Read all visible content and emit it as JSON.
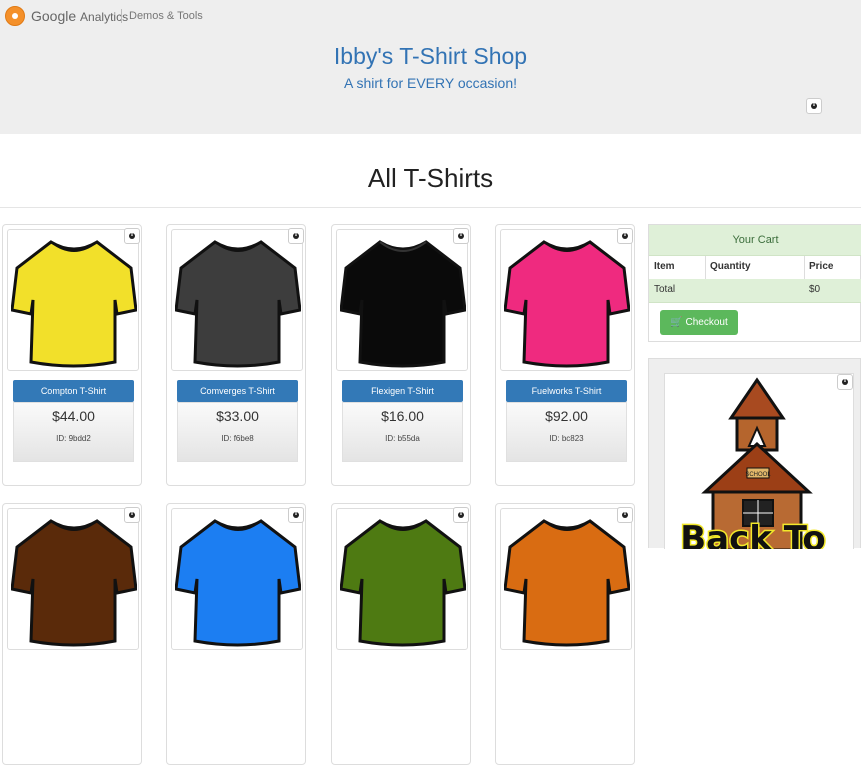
{
  "ga_header": {
    "brand_google": "Google",
    "brand_analytics": "Analytics",
    "demos": "Demos & Tools"
  },
  "hero": {
    "title": "Ibby's T-Shirt Shop",
    "subtitle": "A shirt for EVERY occasion!"
  },
  "section": {
    "title": "All T-Shirts"
  },
  "products": [
    {
      "name": "Compton T-Shirt",
      "price": "$44.00",
      "id": "ID: 9bdd2",
      "color": "#f2e02a"
    },
    {
      "name": "Comverges T-Shirt",
      "price": "$33.00",
      "id": "ID: f6be8",
      "color": "#3d3d3d"
    },
    {
      "name": "Flexigen T-Shirt",
      "price": "$16.00",
      "id": "ID: b55da",
      "color": "#0a0a0a"
    },
    {
      "name": "Fuelworks T-Shirt",
      "price": "$92.00",
      "id": "ID: bc823",
      "color": "#ef2a7f"
    }
  ],
  "products_row2_colors": [
    "#5a2a0a",
    "#1c7ef2",
    "#4e7a12",
    "#d96c12"
  ],
  "cart": {
    "title": "Your Cart",
    "col_item": "Item",
    "col_quantity": "Quantity",
    "col_price": "Price",
    "total_label": "Total",
    "total_value": "$0",
    "checkout_label": "Checkout"
  },
  "promo": {
    "text": "Back To",
    "sign": "SCHOOL"
  },
  "colors": {
    "accent": "#3379b7",
    "title_blue": "#3273b4",
    "cart_green": "#dff0d8",
    "checkout_green": "#5cb85c"
  }
}
